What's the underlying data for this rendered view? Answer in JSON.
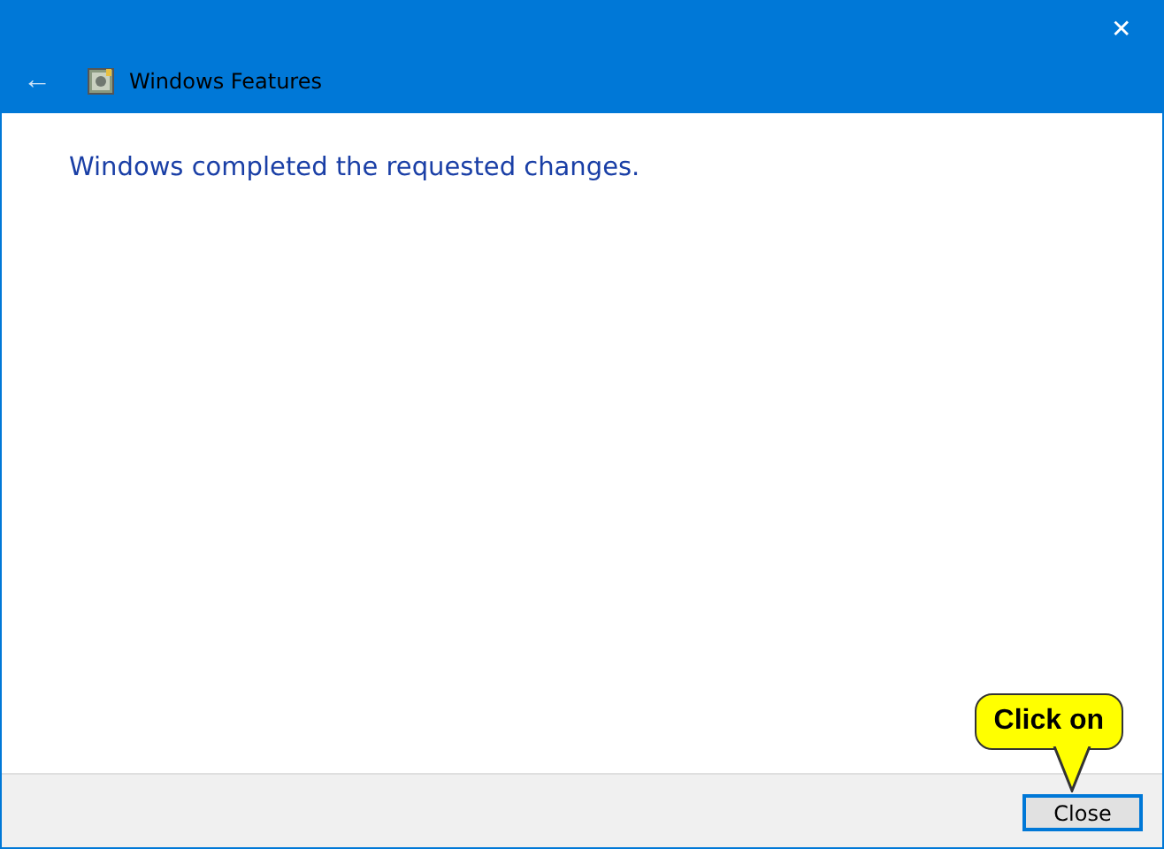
{
  "window": {
    "title": "Windows Features",
    "close": "✕",
    "back": "←"
  },
  "message": "Windows completed the requested changes.",
  "buttons": [
    {
      "label": "Close",
      "focused": true
    }
  ],
  "callout": {
    "text": "Click on"
  }
}
